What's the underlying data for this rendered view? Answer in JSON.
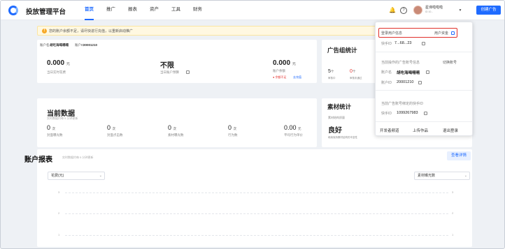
{
  "app": {
    "title": "投放管理平台"
  },
  "nav": [
    "首页",
    "推广",
    "报表",
    "资产",
    "工具",
    "财务"
  ],
  "header": {
    "user_name": "星谛啦啦啦",
    "user_sub": "ID 10...",
    "create_label": "创建广告",
    "notify_icon": "bell-icon",
    "help_icon": "help-icon",
    "chevron_icon": "chevron-down-icon"
  },
  "alert": {
    "text": "您的账户余额不足，请尽快进行充值，以重新启动推广",
    "icon": "warning-icon"
  },
  "account": {
    "name_label": "账户名",
    "name": "胡吃海喝嗝嗝",
    "id_label": "账户ID",
    "id": "20001210"
  },
  "stats": [
    {
      "value": "0.000",
      "unit": "元",
      "label": "当日实时花费"
    },
    {
      "value": "不限",
      "unit": "",
      "label": "当日账户预算"
    },
    {
      "value": "0.000",
      "unit": "元",
      "label": "账户余额"
    }
  ],
  "balance_warn": "余额不足",
  "recharge_label": "去充值",
  "group_stats": {
    "title": "广告组统计",
    "v1": "5",
    "u1": "个",
    "l1": "审核中",
    "v2": "0",
    "u2": "个",
    "l2": "审核未通过"
  },
  "current": {
    "title": "当前数据",
    "sub": "实时数据约每 5 分钟更新",
    "items": [
      {
        "value": "0",
        "unit": "次",
        "label": "封面曝光数"
      },
      {
        "value": "0",
        "unit": "次",
        "label": "封面点击数"
      },
      {
        "value": "0",
        "unit": "次",
        "label": "素材曝光数"
      },
      {
        "value": "0",
        "unit": "次",
        "label": "行为数"
      },
      {
        "value": "0.00",
        "unit": "元",
        "label": "平均行为单价"
      }
    ]
  },
  "material": {
    "title": "素材统计",
    "label": "素材结构质量",
    "value": "良好",
    "desc": "继续保持素材结构的丰富性"
  },
  "report": {
    "title": "账户报表",
    "sub": "实时数据约每 5 分钟更新",
    "view_label": "查看详情",
    "left_select": "花费(元)",
    "right_select": "素材曝光数",
    "ticks": [
      "3",
      "2",
      "1"
    ]
  },
  "popup": {
    "login_title": "登录用户信息",
    "user_assets": "用户资金",
    "kuaishou_label": "快手ID",
    "kuaishou_id": "7...68...23",
    "current_title": "当前操作的广告账号信息",
    "switch_label": "切换账号",
    "acct_name_label": "账户名",
    "acct_name": "胡吃海喝嗝嗝",
    "acct_id_label": "账户ID",
    "acct_id": "20001210",
    "bound_title": "当前广告账号绑定的快手ID",
    "bound_label": "快手ID",
    "bound_id": "1099267983",
    "actions": [
      "开发者频道",
      "上传作品",
      "退出登录"
    ]
  }
}
